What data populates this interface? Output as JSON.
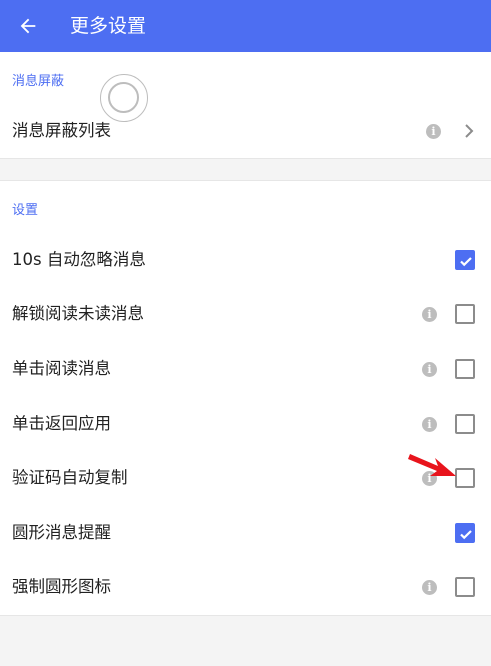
{
  "app_bar": {
    "title": "更多设置"
  },
  "sections": [
    {
      "header": "消息屏蔽",
      "rows": [
        {
          "label": "消息屏蔽列表"
        }
      ]
    },
    {
      "header": "设置",
      "rows": [
        {
          "label": "10s 自动忽略消息",
          "checked": true,
          "has_info": false
        },
        {
          "label": "解锁阅读未读消息",
          "checked": false,
          "has_info": true
        },
        {
          "label": "单击阅读消息",
          "checked": false,
          "has_info": true
        },
        {
          "label": "单击返回应用",
          "checked": false,
          "has_info": true
        },
        {
          "label": "验证码自动复制",
          "checked": false,
          "has_info": true
        },
        {
          "label": "圆形消息提醒",
          "checked": true,
          "has_info": false
        },
        {
          "label": "强制圆形图标",
          "checked": false,
          "has_info": true
        }
      ]
    }
  ],
  "icons": {
    "info_glyph": "i",
    "back": "arrow-left-icon",
    "chevron": "chevron-right-icon"
  },
  "colors": {
    "accent": "#4d6ef2",
    "annotation_arrow": "#e8141c"
  }
}
